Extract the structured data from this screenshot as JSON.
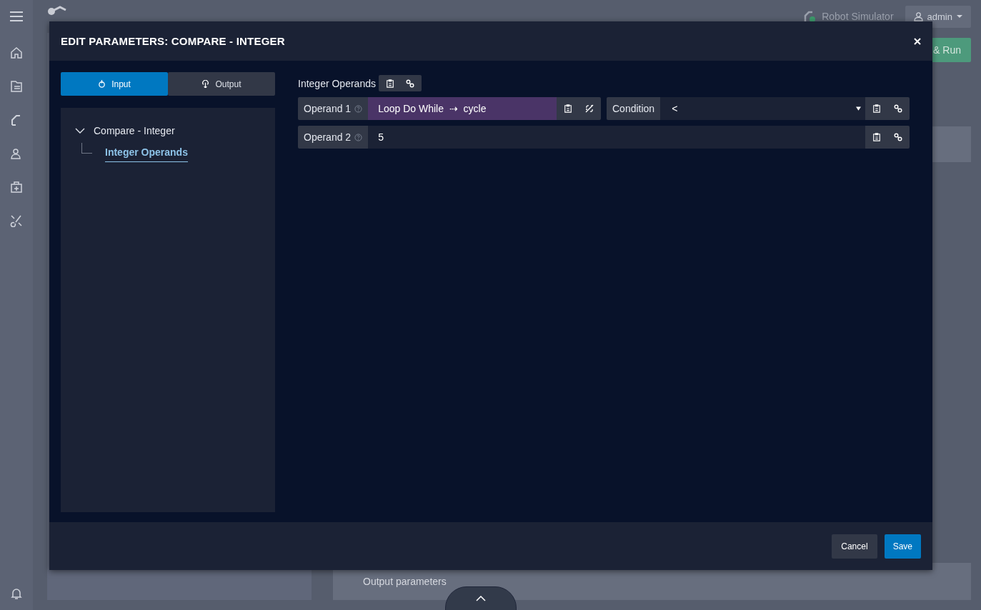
{
  "app": {
    "robot_status": "Robot Simulator",
    "user": "admin",
    "run_button": "& Run",
    "output_section": "Output parameters"
  },
  "dialog": {
    "title": "EDIT PARAMETERS: COMPARE - INTEGER",
    "tabs": [
      {
        "label": "Input",
        "kind": "input",
        "selected": true
      },
      {
        "label": "Output",
        "kind": "output",
        "selected": false
      }
    ],
    "tree": {
      "label": "Compare - Integer",
      "expanded": true,
      "children": [
        {
          "label": "Integer Operands",
          "selected": true
        }
      ]
    },
    "group_title": "Integer Operands",
    "rows": [
      [
        {
          "kind": "input",
          "label": "Operand 1",
          "help": true,
          "linked": true,
          "value": "Loop Do While  ⇢  cycle"
        },
        {
          "kind": "select",
          "label": "Condition",
          "help": false,
          "linked": false,
          "value": "<"
        }
      ],
      [
        {
          "kind": "input",
          "label": "Operand 2",
          "help": true,
          "linked": false,
          "value": "5"
        }
      ]
    ],
    "buttons": [
      {
        "label": "Cancel",
        "kind": "secondary"
      },
      {
        "label": "Save",
        "kind": "primary"
      }
    ]
  }
}
